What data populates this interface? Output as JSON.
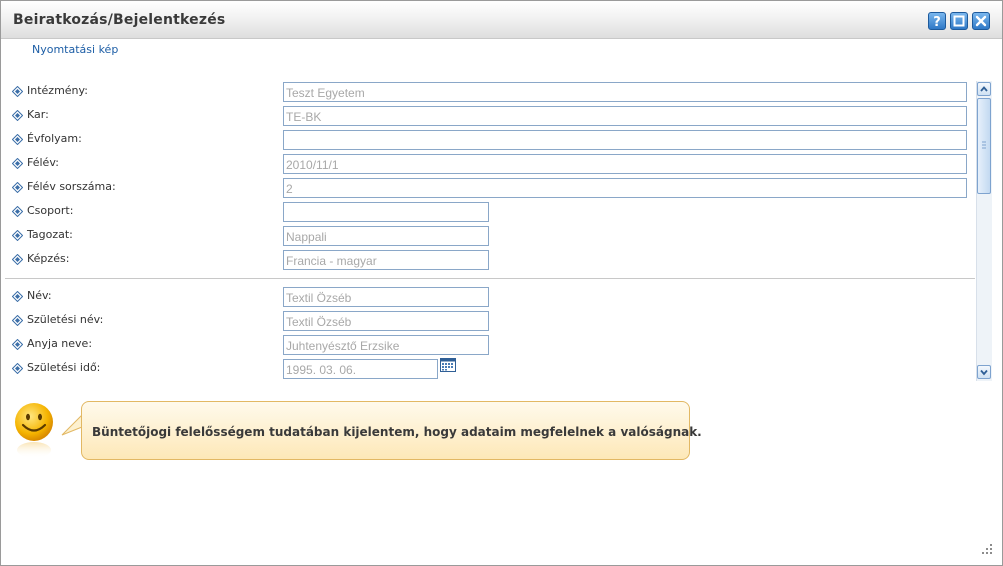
{
  "window": {
    "title": "Beiratkozás/Bejelentkezés",
    "buttons": {
      "help": "help-icon",
      "maximize": "maximize-icon",
      "close": "close-icon"
    }
  },
  "print_link": "Nyomtatási kép",
  "form": {
    "institution": {
      "label": "Intézmény:",
      "value": "Teszt Egyetem"
    },
    "faculty": {
      "label": "Kar:",
      "value": "TE-BK"
    },
    "year": {
      "label": "Évfolyam:",
      "value": ""
    },
    "semester": {
      "label": "Félév:",
      "value": "2010/11/1"
    },
    "semester_number": {
      "label": "Félév sorszáma:",
      "value": "2"
    },
    "group": {
      "label": "Csoport:",
      "value": ""
    },
    "division": {
      "label": "Tagozat:",
      "value": "Nappali"
    },
    "training": {
      "label": "Képzés:",
      "value": "Francia - magyar"
    },
    "name": {
      "label": "Név:",
      "value": "Textil Özséb"
    },
    "birth_name": {
      "label": "Születési név:",
      "value": "Textil Özséb"
    },
    "mother_name": {
      "label": "Anyja neve:",
      "value": "Juhtenyésztő Erzsike"
    },
    "birth_date": {
      "label": "Születési idő:",
      "value": "1995. 03. 06."
    }
  },
  "notice": {
    "text": "Büntetőjogi felelősségem tudatában kijelentem, hogy adataim megfelelnek a valóságnak.",
    "icon": "smiley-icon"
  },
  "colors": {
    "accent": "#2f78c6",
    "bubble": "#fde8b8",
    "bubble_border": "#e2b864",
    "field_border": "#8aa7c8",
    "bullet": "#3b6ea8"
  }
}
